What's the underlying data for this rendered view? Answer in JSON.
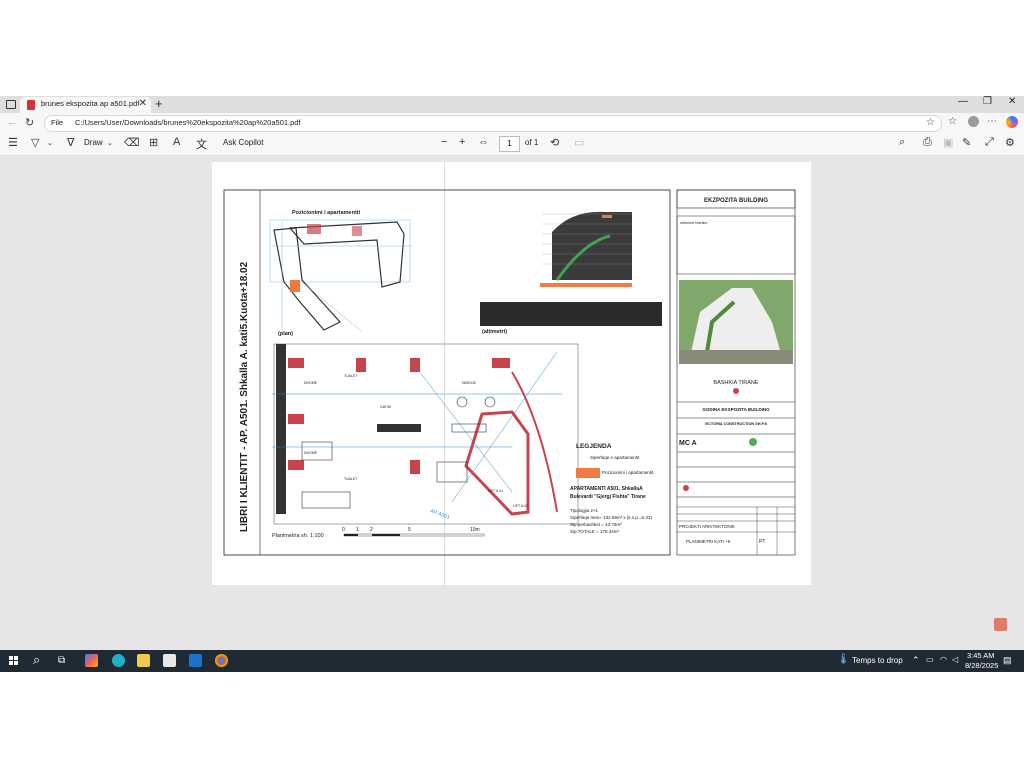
{
  "browser": {
    "tab_title": "brunes ekspozita ap a501.pdf",
    "new_tab_symbol": "+",
    "address_label": "File",
    "url": "C:/Users/User/Downloads/brunes%20ekspozita%20ap%20a501.pdf"
  },
  "pdf_toolbar": {
    "draw_label": "Draw",
    "ask_copilot_label": "Ask Copilot",
    "page_current": "1",
    "page_of": "of 1"
  },
  "document": {
    "title_block": "EKZPOZITA BUILDING",
    "notes_label": "shënime teknike",
    "left_title": "LIBRI I KLIENTIT  -  AP. A501. Shkalla A. kati5.Kuota+18.02",
    "positioning_label": "Pozicionimi i apartamentit",
    "plan_caption": "(plan)",
    "altimetri_caption": "(altimetri)",
    "legend_title": "LEGJENDA",
    "legend_area": "Siperfaqe e apartamentit",
    "legend_position": "Pozicionimi i apartamentit",
    "apartment_title": "APARTAMENTI A501. ShkallaA",
    "apartment_address": "Bulevardi \"Gjergj Fishta\" Tirane",
    "typology": "Tipologjia 2+1",
    "net_area": "Siperfaqe neto= 132.59m² x (k.s.p.=0.33)",
    "balcony_area": "Sip.perbashket = 43.75m²",
    "total_area": "Sip.TOTALE = 176.34m²",
    "plan_scale": "Planimetria sh. 1:100",
    "scale_ticks": [
      "0",
      "1",
      "2",
      "5",
      "10m"
    ],
    "municipality": "BASHKIA TIRANE",
    "building_name": "GODINA EKSPOZITA BUILDING",
    "contractor": "VICTORIA CONSTRUCTION SH.P.K",
    "architect_logo": "MC A",
    "project_label": "PROJEKTI ARKITEKTONIK",
    "sheet_title": "PLANIMETRI KATI +5",
    "sheet_code": "PT",
    "lift_labels": [
      "LIFT A.01",
      "LIFT A.02"
    ],
    "room_labels": [
      "DHOME",
      "TUALET",
      "GATIM",
      "NDENJE",
      "DHOME",
      "TUALET"
    ],
    "label_ap": "AP. A501"
  },
  "taskbar": {
    "weather": "Temps to drop",
    "time": "3:45 AM",
    "date": "8/28/2025"
  },
  "colors": {
    "accent_orange": "#f07a3f",
    "wall_red": "#c9434d",
    "axis_blue": "#2a8ad6",
    "taskbar": "#1f2a35"
  }
}
